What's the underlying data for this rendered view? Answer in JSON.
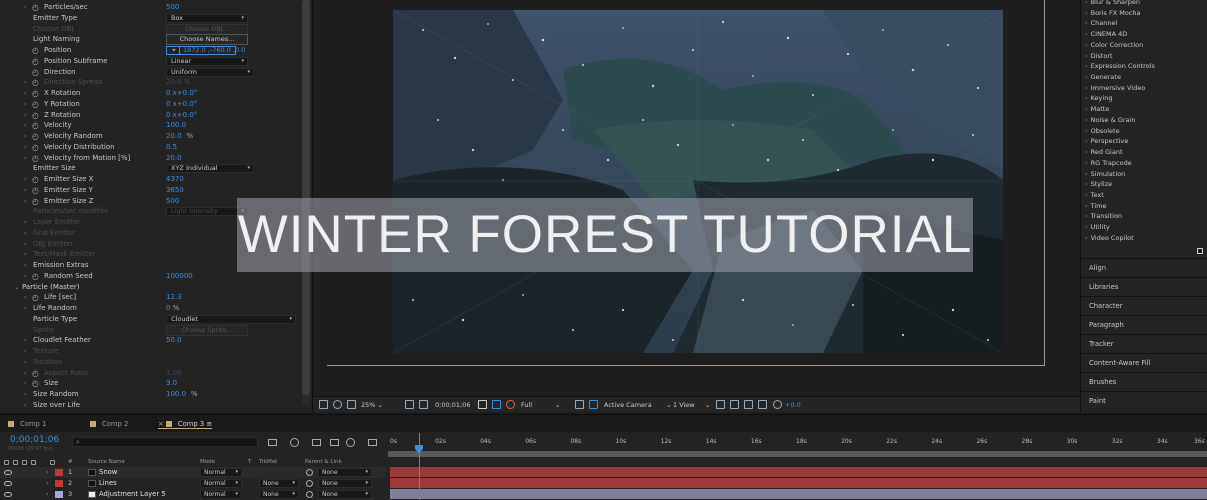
{
  "effect_controls": {
    "rows": [
      {
        "label": "Particles/sec",
        "value": "500",
        "type": "value",
        "twirl": true,
        "stopwatch": true
      },
      {
        "label": "Emitter Type",
        "value": "Box",
        "type": "dropdown"
      },
      {
        "label": "Choose OBJ",
        "value": "Choose OBJ...",
        "type": "button",
        "disabled": true
      },
      {
        "label": "Light Naming",
        "value": "Choose Names...",
        "type": "button"
      },
      {
        "label": "Position",
        "value": "1872.0 ,-760.0 ,0.0",
        "type": "position",
        "stopwatch": true
      },
      {
        "label": "Position Subframe",
        "value": "Linear",
        "type": "dropdown",
        "stopwatch": true
      },
      {
        "label": "Direction",
        "value": "Uniform",
        "type": "dropdown",
        "stopwatch": true
      },
      {
        "label": "Direction Spread",
        "value": "20.0 %",
        "type": "value",
        "twirl": true,
        "stopwatch": true,
        "disabled": true
      },
      {
        "label": "X Rotation",
        "value": "0 x+0.0°",
        "type": "value",
        "twirl": true,
        "stopwatch": true
      },
      {
        "label": "Y Rotation",
        "value": "0 x+0.0°",
        "type": "value",
        "twirl": true,
        "stopwatch": true
      },
      {
        "label": "Z Rotation",
        "value": "0 x+0.0°",
        "type": "value",
        "twirl": true,
        "stopwatch": true
      },
      {
        "label": "Velocity",
        "value": "100.0",
        "type": "value",
        "twirl": true,
        "stopwatch": true
      },
      {
        "label": "Velocity Random",
        "value": "20.0",
        "unit": "%",
        "type": "value",
        "twirl": true,
        "stopwatch": true
      },
      {
        "label": "Velocity Distribution",
        "value": "0.5",
        "type": "value",
        "twirl": true,
        "stopwatch": true
      },
      {
        "label": "Velocity from Motion [%]",
        "value": "20.0",
        "type": "value",
        "twirl": true,
        "stopwatch": true
      },
      {
        "label": "Emitter Size",
        "value": "XYZ Individual",
        "type": "dropdown"
      },
      {
        "label": "Emitter Size X",
        "value": "4370",
        "type": "value",
        "twirl": true,
        "stopwatch": true
      },
      {
        "label": "Emitter Size Y",
        "value": "3650",
        "type": "value",
        "twirl": true,
        "stopwatch": true
      },
      {
        "label": "Emitter Size Z",
        "value": "500",
        "type": "value",
        "twirl": true,
        "stopwatch": true
      },
      {
        "label": "Particles/sec modifier",
        "value": "Light Intensity",
        "type": "dropdown",
        "disabled": true
      },
      {
        "label": "Layer Emitter",
        "value": "",
        "type": "group",
        "twirl": true,
        "disabled": true
      },
      {
        "label": "Grid Emitter",
        "value": "",
        "type": "group",
        "twirl": true,
        "disabled": true
      },
      {
        "label": "OBJ Emitter",
        "value": "",
        "type": "group",
        "twirl": true,
        "disabled": true
      },
      {
        "label": "Text/Mask Emitter",
        "value": "",
        "type": "group",
        "twirl": true,
        "disabled": true
      },
      {
        "label": "Emission Extras",
        "value": "",
        "type": "group",
        "twirl": true
      },
      {
        "label": "Random Seed",
        "value": "100000",
        "type": "value",
        "twirl": true,
        "stopwatch": true
      },
      {
        "label": "Particle (Master)",
        "value": "",
        "type": "section",
        "twirl": true,
        "open": true
      },
      {
        "label": "Life [sec]",
        "value": "12.3",
        "type": "value",
        "twirl": true,
        "stopwatch": true
      },
      {
        "label": "Life Random",
        "value": "0",
        "unit": "%",
        "type": "value",
        "twirl": true
      },
      {
        "label": "Particle Type",
        "value": "Cloudlet",
        "type": "dropdown"
      },
      {
        "label": "Sprite",
        "value": "Choose Sprite...",
        "type": "button",
        "disabled": true
      },
      {
        "label": "Cloudlet Feather",
        "value": "50.0",
        "type": "value",
        "twirl": true
      },
      {
        "label": "Texture",
        "value": "",
        "type": "group",
        "twirl": true,
        "disabled": true
      },
      {
        "label": "Rotation",
        "value": "",
        "type": "group",
        "twirl": true,
        "disabled": true
      },
      {
        "label": "Aspect Ratio",
        "value": "1.00",
        "type": "value",
        "twirl": true,
        "stopwatch": true,
        "disabled": true
      },
      {
        "label": "Size",
        "value": "3.0",
        "type": "value",
        "twirl": true,
        "stopwatch": true
      },
      {
        "label": "Size Random",
        "value": "100.0",
        "unit": "%",
        "type": "value",
        "twirl": true
      },
      {
        "label": "Size over Life",
        "value": "",
        "type": "group",
        "twirl": true
      }
    ]
  },
  "viewer": {
    "title_overlay": "WINTER FOREST TUTORIAL",
    "toolbar": {
      "zoom": "25%",
      "timecode": "0;00;01;06",
      "resolution": "Full",
      "camera": "Active Camera",
      "view": "1 View",
      "exposure": "+0.0"
    }
  },
  "effects_presets": {
    "categories": [
      "Blur & Sharpen",
      "Boris FX Mocha",
      "Channel",
      "CINEMA 4D",
      "Color Correction",
      "Distort",
      "Expression Controls",
      "Generate",
      "Immersive Video",
      "Keying",
      "Matte",
      "Noise & Grain",
      "Obsolete",
      "Perspective",
      "Red Giant",
      "RG Trapcode",
      "Simulation",
      "Stylize",
      "Text",
      "Time",
      "Transition",
      "Utility",
      "Video Copilot"
    ]
  },
  "side_panels": [
    "Align",
    "Libraries",
    "Character",
    "Paragraph",
    "Tracker",
    "Content-Aware Fill",
    "Brushes",
    "Paint"
  ],
  "timeline": {
    "tabs": [
      {
        "label": "Comp 1",
        "active": false
      },
      {
        "label": "Comp 2",
        "active": false
      },
      {
        "label": "Comp 3",
        "active": true
      }
    ],
    "timecode": "0;00;01;06",
    "timecode_sub": "00036 (29.97 fps)",
    "columns": {
      "source_name": "Source Name",
      "mode": "Mode",
      "t": "T",
      "trkmat": "TrkMat",
      "parent": "Parent & Link",
      "hash": "#"
    },
    "ruler_ticks": [
      "0s",
      "02s",
      "04s",
      "06s",
      "08s",
      "10s",
      "12s",
      "14s",
      "16s",
      "18s",
      "20s",
      "22s",
      "24s",
      "26s",
      "28s",
      "30s",
      "32s",
      "34s",
      "36s"
    ],
    "layers": [
      {
        "index": "1",
        "name": "Snow",
        "mode": "Normal",
        "trkmat": "",
        "parent": "None",
        "label_color": "#c43838",
        "bar_color": "#9b3a3a"
      },
      {
        "index": "2",
        "name": "Lines",
        "mode": "Normal",
        "trkmat": "None",
        "parent": "None",
        "label_color": "#c43838",
        "bar_color": "#9b3a3a"
      },
      {
        "index": "3",
        "name": "Adjustment Layer 5",
        "mode": "Normal",
        "trkmat": "None",
        "parent": "None",
        "label_color": "#a8a8d8",
        "bar_color": "#7f7f9a"
      }
    ]
  },
  "colors": {
    "accent": "#3c8fe0",
    "panel": "#232323"
  }
}
